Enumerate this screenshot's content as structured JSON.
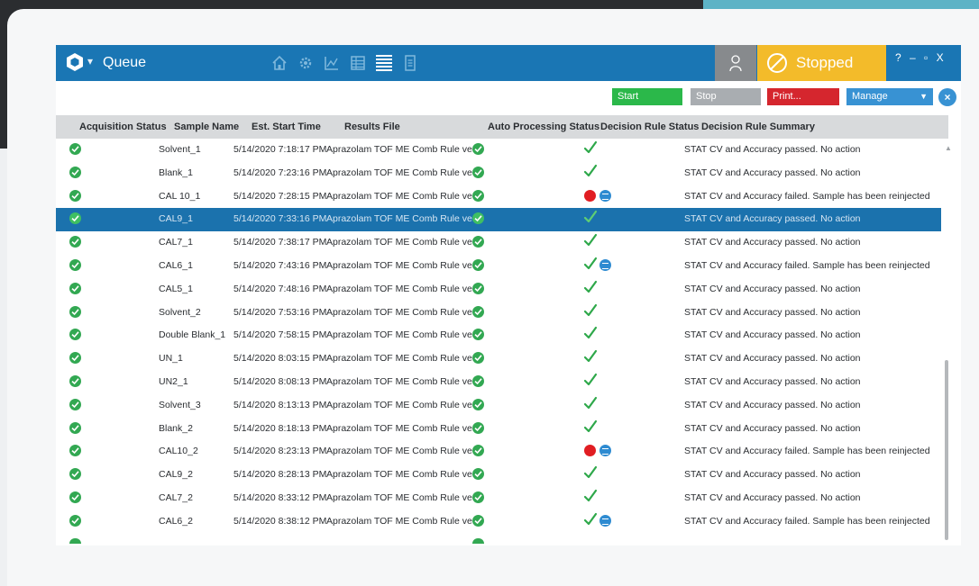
{
  "titlebar": {
    "title": "Queue",
    "status_label": "Stopped",
    "window_controls": "? – ▫ X",
    "colors": {
      "bar": "#1a76b4",
      "stopped": "#f3bb2a",
      "user": "#878a8d"
    }
  },
  "nav": {
    "icons": [
      "home-icon",
      "gear-icon",
      "chart-icon",
      "table-icon",
      "queue-list-icon",
      "document-icon"
    ],
    "active": "queue-list-icon"
  },
  "toolbar": {
    "start_label": "Start",
    "stop_label": "Stop",
    "print_label": "Print...",
    "manage_label": "Manage"
  },
  "table": {
    "columns": {
      "acq": "Acquisition Status",
      "sample": "Sample Name",
      "est": "Est. Start Time",
      "results": "Results File",
      "auto": "Auto Processing Status",
      "decision": "Decision Rule Status",
      "summary": "Decision Rule Summary"
    },
    "selected_index": 3,
    "rows": [
      {
        "acq": "ok",
        "sample": "Solvent_1",
        "est": "5/14/2020 7:18:17 PM",
        "results": "Aprazolam TOF ME Comb Rule ve...",
        "auto": "ok",
        "decision": "pass",
        "summary": "STAT CV and Accuracy passed. No action"
      },
      {
        "acq": "ok",
        "sample": "Blank_1",
        "est": "5/14/2020 7:23:16 PM",
        "results": "Aprazolam TOF ME Comb Rule ve...",
        "auto": "ok",
        "decision": "pass",
        "summary": "STAT CV and Accuracy passed. No action"
      },
      {
        "acq": "ok",
        "sample": "CAL 10_1",
        "est": "5/14/2020 7:28:15 PM",
        "results": "Aprazolam TOF ME Comb Rule ve...",
        "auto": "ok",
        "decision": "fail",
        "summary": "STAT CV and Accuracy failed. Sample has been reinjected"
      },
      {
        "acq": "ok",
        "sample": "CAL9_1",
        "est": "5/14/2020 7:33:16 PM",
        "results": "Aprazolam TOF ME Comb Rule ve...",
        "auto": "ok",
        "decision": "pass",
        "summary": "STAT CV and Accuracy passed. No action"
      },
      {
        "acq": "ok",
        "sample": "CAL7_1",
        "est": "5/14/2020 7:38:17 PM",
        "results": "Aprazolam TOF ME Comb Rule ve...",
        "auto": "ok",
        "decision": "pass",
        "summary": "STAT CV and Accuracy passed. No action"
      },
      {
        "acq": "ok",
        "sample": "CAL6_1",
        "est": "5/14/2020 7:43:16 PM",
        "results": "Aprazolam TOF ME Comb Rule ve...",
        "auto": "ok",
        "decision": "pass-info",
        "summary": "STAT CV and Accuracy failed. Sample has been reinjected"
      },
      {
        "acq": "ok",
        "sample": "CAL5_1",
        "est": "5/14/2020 7:48:16 PM",
        "results": "Aprazolam TOF ME Comb Rule ve...",
        "auto": "ok",
        "decision": "pass",
        "summary": "STAT CV and Accuracy passed. No action"
      },
      {
        "acq": "ok",
        "sample": "Solvent_2",
        "est": "5/14/2020 7:53:16 PM",
        "results": "Aprazolam TOF ME Comb Rule ve...",
        "auto": "ok",
        "decision": "pass",
        "summary": "STAT CV and Accuracy passed. No action"
      },
      {
        "acq": "ok",
        "sample": "Double Blank_1",
        "est": "5/14/2020 7:58:15 PM",
        "results": "Aprazolam TOF ME Comb Rule ve...",
        "auto": "ok",
        "decision": "pass",
        "summary": "STAT CV and Accuracy passed. No action"
      },
      {
        "acq": "ok",
        "sample": "UN_1",
        "est": "5/14/2020 8:03:15 PM",
        "results": "Aprazolam TOF ME Comb Rule ve...",
        "auto": "ok",
        "decision": "pass",
        "summary": "STAT CV and Accuracy passed. No action"
      },
      {
        "acq": "ok",
        "sample": "UN2_1",
        "est": "5/14/2020 8:08:13 PM",
        "results": "Aprazolam TOF ME Comb Rule ve...",
        "auto": "ok",
        "decision": "pass",
        "summary": "STAT CV and Accuracy passed. No action"
      },
      {
        "acq": "ok",
        "sample": "Solvent_3",
        "est": "5/14/2020 8:13:13 PM",
        "results": "Aprazolam TOF ME Comb Rule ve...",
        "auto": "ok",
        "decision": "pass",
        "summary": "STAT CV and Accuracy passed. No action"
      },
      {
        "acq": "ok",
        "sample": "Blank_2",
        "est": "5/14/2020 8:18:13 PM",
        "results": "Aprazolam TOF ME Comb Rule ve...",
        "auto": "ok",
        "decision": "pass",
        "summary": "STAT CV and Accuracy passed. No action"
      },
      {
        "acq": "ok",
        "sample": "CAL10_2",
        "est": "5/14/2020 8:23:13 PM",
        "results": "Aprazolam TOF ME Comb Rule ve...",
        "auto": "ok",
        "decision": "fail",
        "summary": "STAT CV and Accuracy failed. Sample has been reinjected"
      },
      {
        "acq": "ok",
        "sample": "CAL9_2",
        "est": "5/14/2020 8:28:13 PM",
        "results": "Aprazolam TOF ME Comb Rule ve...",
        "auto": "ok",
        "decision": "pass",
        "summary": "STAT CV and Accuracy passed. No action"
      },
      {
        "acq": "ok",
        "sample": "CAL7_2",
        "est": "5/14/2020 8:33:12 PM",
        "results": "Aprazolam TOF ME Comb Rule ve...",
        "auto": "ok",
        "decision": "pass",
        "summary": "STAT CV and Accuracy passed. No action"
      },
      {
        "acq": "ok",
        "sample": "CAL6_2",
        "est": "5/14/2020 8:38:12 PM",
        "results": "Aprazolam TOF ME Comb Rule ve...",
        "auto": "ok",
        "decision": "pass-info",
        "summary": "STAT CV and Accuracy failed. Sample has been reinjected"
      }
    ]
  }
}
